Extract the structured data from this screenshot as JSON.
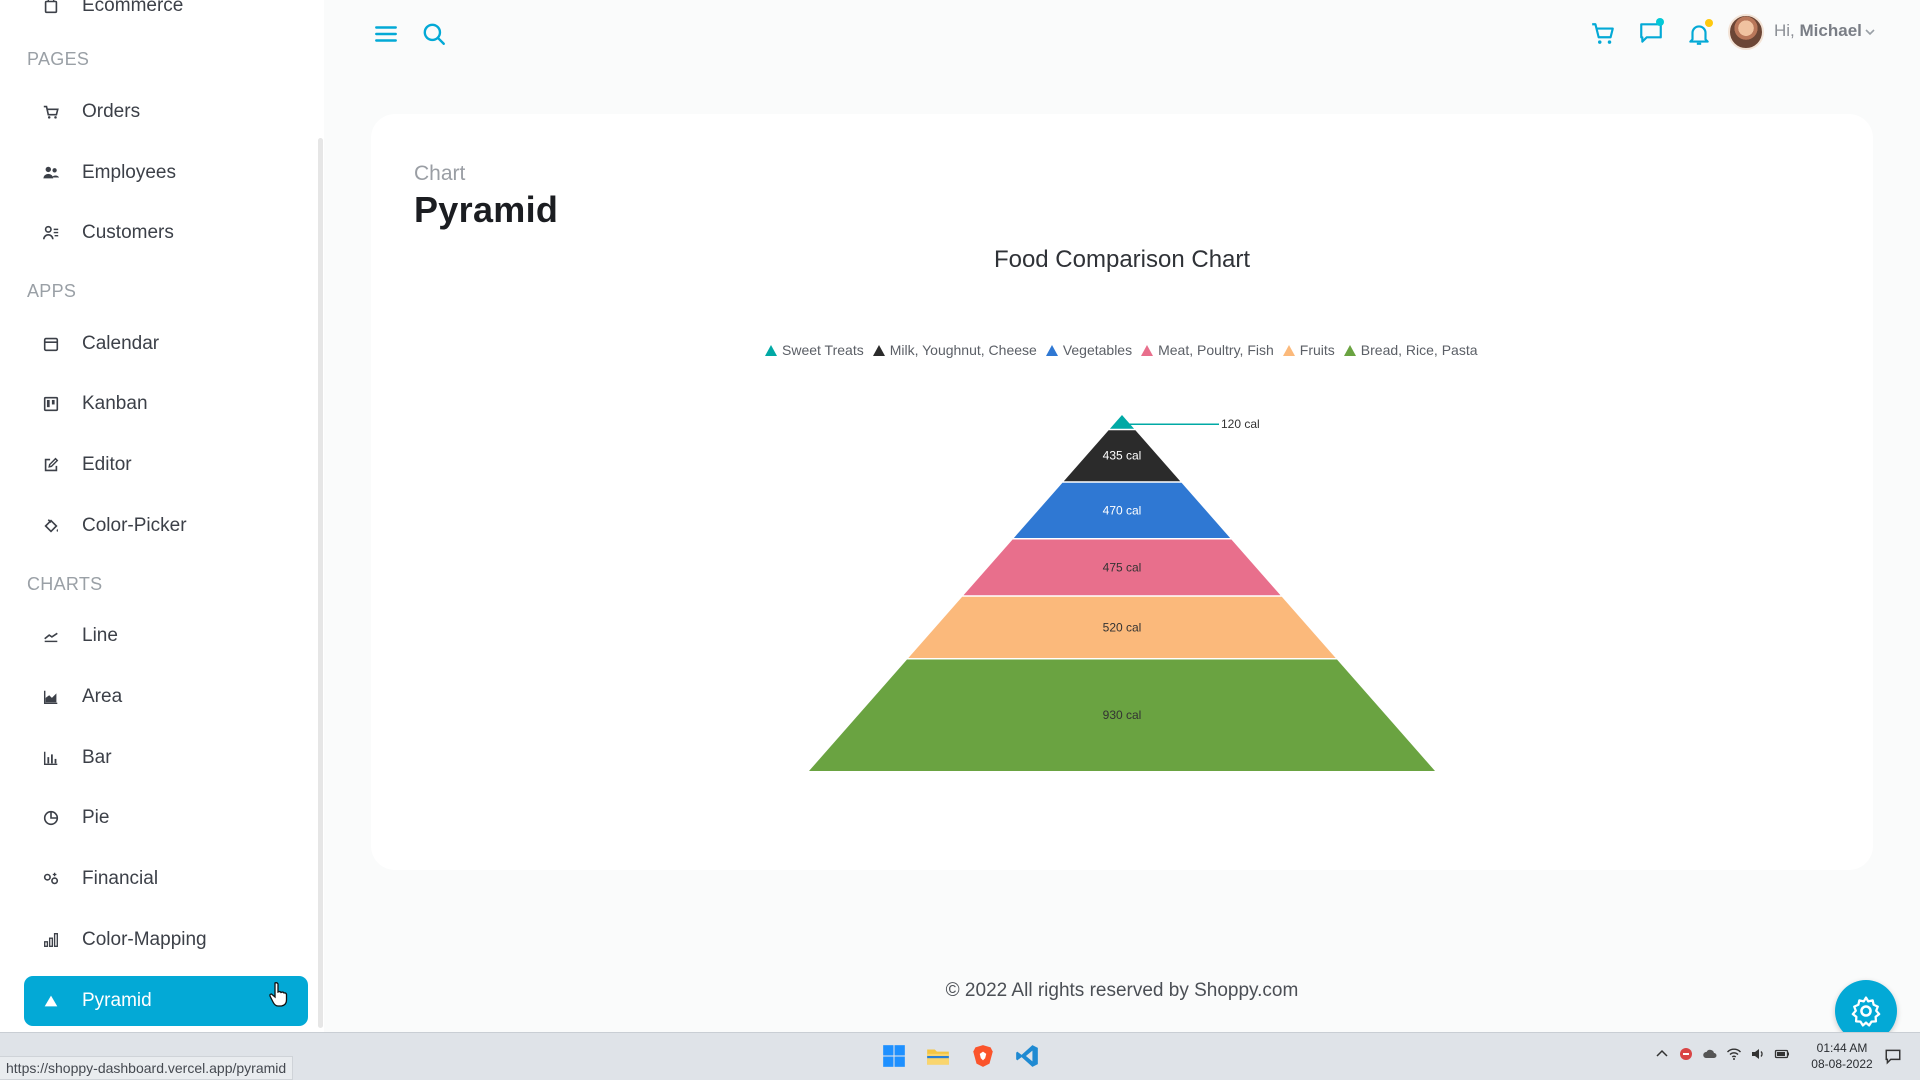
{
  "sidebar": {
    "top_item": "Ecommerce",
    "sections": {
      "pages": "PAGES",
      "apps": "APPS",
      "charts": "CHARTS"
    },
    "pages": [
      "Orders",
      "Employees",
      "Customers"
    ],
    "apps": [
      "Calendar",
      "Kanban",
      "Editor",
      "Color-Picker"
    ],
    "charts": [
      "Line",
      "Area",
      "Bar",
      "Pie",
      "Financial",
      "Color-Mapping",
      "Pyramid"
    ],
    "active": "Pyramid"
  },
  "topbar": {
    "greeting": "Hi,",
    "user_name": "Michael",
    "icons": [
      "menu-icon",
      "search-icon",
      "cart-icon",
      "chat-icon",
      "bell-icon"
    ],
    "accent": "#03a9d6"
  },
  "main": {
    "breadcrumb": "Chart",
    "title": "Pyramid"
  },
  "chart_data": {
    "type": "pyramid",
    "title": "Food Comparison Chart",
    "legend_position": "top",
    "categories": [
      "Sweet Treats",
      "Milk, Youghnut, Cheese",
      "Vegetables",
      "Meat, Poultry, Fish",
      "Fruits",
      "Bread, Rice, Pasta"
    ],
    "values": [
      120,
      435,
      470,
      475,
      520,
      930
    ],
    "labels": [
      "120 cal",
      "435 cal",
      "470 cal",
      "475 cal",
      "520 cal",
      "930 cal"
    ],
    "colors": [
      "#00a9a5",
      "#2b2b2b",
      "#2f78d3",
      "#e86f8c",
      "#fbb97b",
      "#6aa341"
    ]
  },
  "footer": "© 2022 All rights reserved by Shoppy.com",
  "status_url": "https://shoppy-dashboard.vercel.app/pyramid",
  "taskbar": {
    "apps": [
      "windows-start-icon",
      "file-explorer-icon",
      "brave-browser-icon",
      "vscode-icon"
    ],
    "time": "01:44 AM",
    "date": "08-08-2022"
  }
}
